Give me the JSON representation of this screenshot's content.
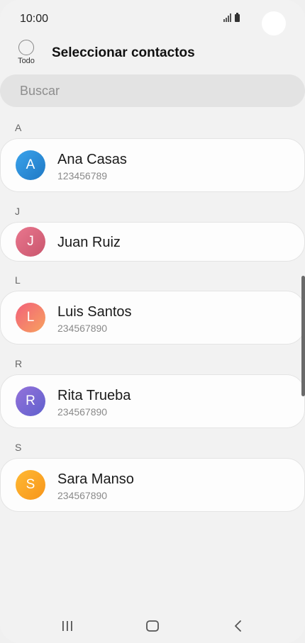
{
  "status_bar": {
    "time": "10:00"
  },
  "header": {
    "select_all_label": "Todo",
    "title": "Seleccionar contactos"
  },
  "search": {
    "placeholder": "Buscar"
  },
  "contacts": [
    {
      "letter": "A",
      "initial": "A",
      "name": "Ana Casas",
      "number": "123456789",
      "color_start": "#3a9ee8",
      "color_end": "#1f78c4"
    },
    {
      "letter": "J",
      "initial": "J",
      "name": "Juan Ruiz",
      "number": "",
      "color_start": "#e56d85",
      "color_end": "#c9556d"
    },
    {
      "letter": "L",
      "initial": "L",
      "name": "Luis Santos",
      "number": "234567890",
      "color_start": "#f2667a",
      "color_end": "#f59a62"
    },
    {
      "letter": "R",
      "initial": "R",
      "name": "Rita Trueba",
      "number": "234567890",
      "color_start": "#8b6fd6",
      "color_end": "#6a62d0"
    },
    {
      "letter": "S",
      "initial": "S",
      "name": "Sara Manso",
      "number": "234567890",
      "color_start": "#ffb12a",
      "color_end": "#f89b1b"
    }
  ],
  "navbar": {
    "recents_icon": "recents-icon",
    "home_icon": "home-icon",
    "back_icon": "back-icon"
  }
}
